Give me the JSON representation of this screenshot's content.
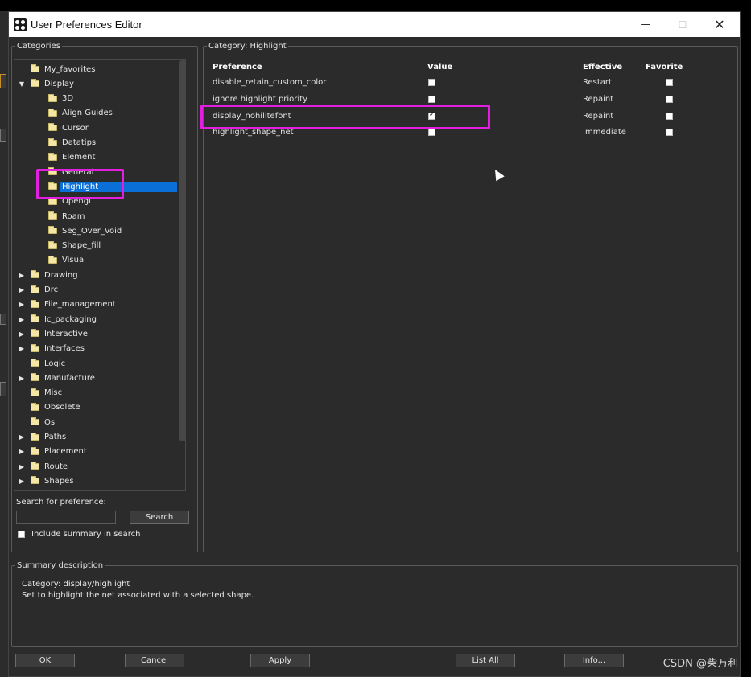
{
  "window": {
    "title": "User Preferences Editor",
    "minimize_symbol": "—",
    "maximize_symbol": "☐",
    "close_symbol": "✕"
  },
  "categories": {
    "legend": "Categories",
    "items": [
      {
        "label": "My_favorites",
        "indent": 1,
        "expandable": false,
        "expanded": false
      },
      {
        "label": "Display",
        "indent": 0,
        "expandable": true,
        "expanded": true
      },
      {
        "label": "3D",
        "indent": 2,
        "expandable": false
      },
      {
        "label": "Align Guides",
        "indent": 2,
        "expandable": false
      },
      {
        "label": "Cursor",
        "indent": 2,
        "expandable": false
      },
      {
        "label": "Datatips",
        "indent": 2,
        "expandable": false
      },
      {
        "label": "Element",
        "indent": 2,
        "expandable": false
      },
      {
        "label": "General",
        "indent": 2,
        "expandable": false
      },
      {
        "label": "Highlight",
        "indent": 2,
        "expandable": false,
        "selected": true
      },
      {
        "label": "Opengl",
        "indent": 2,
        "expandable": false
      },
      {
        "label": "Roam",
        "indent": 2,
        "expandable": false
      },
      {
        "label": "Seg_Over_Void",
        "indent": 2,
        "expandable": false
      },
      {
        "label": "Shape_fill",
        "indent": 2,
        "expandable": false
      },
      {
        "label": "Visual",
        "indent": 2,
        "expandable": false
      },
      {
        "label": "Drawing",
        "indent": 0,
        "expandable": true
      },
      {
        "label": "Drc",
        "indent": 0,
        "expandable": true
      },
      {
        "label": "File_management",
        "indent": 0,
        "expandable": true
      },
      {
        "label": "Ic_packaging",
        "indent": 0,
        "expandable": true
      },
      {
        "label": "Interactive",
        "indent": 0,
        "expandable": true
      },
      {
        "label": "Interfaces",
        "indent": 0,
        "expandable": true
      },
      {
        "label": "Logic",
        "indent": 1,
        "expandable": false
      },
      {
        "label": "Manufacture",
        "indent": 0,
        "expandable": true
      },
      {
        "label": "Misc",
        "indent": 1,
        "expandable": false
      },
      {
        "label": "Obsolete",
        "indent": 1,
        "expandable": false
      },
      {
        "label": "Os",
        "indent": 1,
        "expandable": false
      },
      {
        "label": "Paths",
        "indent": 0,
        "expandable": true
      },
      {
        "label": "Placement",
        "indent": 0,
        "expandable": true
      },
      {
        "label": "Route",
        "indent": 0,
        "expandable": true
      },
      {
        "label": "Shapes",
        "indent": 0,
        "expandable": true
      }
    ],
    "search_label": "Search for preference:",
    "search_value": "",
    "search_button": "Search",
    "include_summary_label": "Include summary in search",
    "include_summary_checked": false
  },
  "category_panel": {
    "legend": "Category:  Highlight",
    "columns": {
      "preference": "Preference",
      "value": "Value",
      "effective": "Effective",
      "favorite": "Favorite"
    },
    "rows": [
      {
        "preference": "disable_retain_custom_color",
        "value": false,
        "effective": "Restart",
        "favorite": false
      },
      {
        "preference": "ignore highlight priority",
        "value": false,
        "effective": "Repaint",
        "favorite": false
      },
      {
        "preference": "display_nohilitefont",
        "value": true,
        "effective": "Repaint",
        "favorite": false
      },
      {
        "preference": "highlight_shape_net",
        "value": false,
        "effective": "Immediate",
        "favorite": false
      }
    ]
  },
  "summary": {
    "legend": "Summary description",
    "line1": "Category: display/highlight",
    "line2": "Set to highlight the net associated with a selected shape."
  },
  "buttons": {
    "ok": "OK",
    "cancel": "Cancel",
    "apply": "Apply",
    "list_all": "List All",
    "info": "Info..."
  },
  "watermark": "CSDN @柴万利",
  "colors": {
    "annotation": "#e21fe0",
    "selection": "#0a6fd6"
  }
}
